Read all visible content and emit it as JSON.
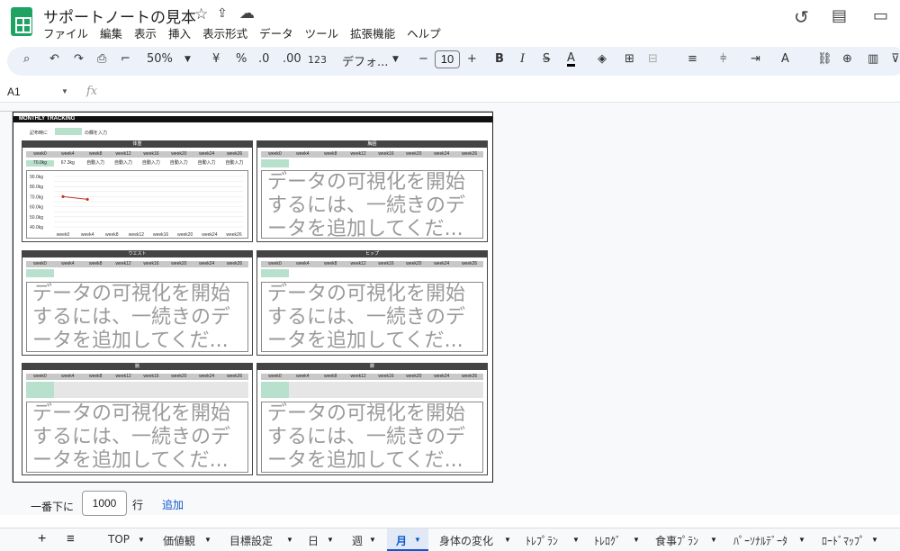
{
  "doc": {
    "title": "サポートノートの見本"
  },
  "menu": [
    "ファイル",
    "編集",
    "表示",
    "挿入",
    "表示形式",
    "データ",
    "ツール",
    "拡張機能",
    "ヘルプ"
  ],
  "toolbar": {
    "zoom": "50%",
    "yen": "¥",
    "percent": "%",
    "dec_dec": ".0",
    "dec_inc": ".00",
    "num_fmt": "123",
    "font": "デフォ...",
    "font_size": "10"
  },
  "cellref": "A1",
  "fx": "fx",
  "sheet": {
    "tracking_title": "MONTHLY TRACKING",
    "note_pre": "記布時に",
    "note_post": "の欄を入力"
  },
  "weeks": [
    "week0",
    "week4",
    "week8",
    "week12",
    "week16",
    "week20",
    "week24",
    "week26"
  ],
  "panels": {
    "weight": {
      "title": "体重",
      "values": [
        "70.0kg",
        "67.3kg",
        "自動入力",
        "自動入力",
        "自動入力",
        "自動入力",
        "自動入力",
        "自動入力"
      ]
    },
    "chest": {
      "title": "胸囲"
    },
    "waist": {
      "title": "ウエスト"
    },
    "hip": {
      "title": "ヒップ"
    },
    "arm": {
      "title": "腕"
    },
    "leg": {
      "title": "脚"
    }
  },
  "placeholder": "データの可視化を開始\nするには、一続きのデ\nータを追加してくだ...",
  "chart_data": {
    "type": "line",
    "categories": [
      "week0",
      "week4",
      "week8",
      "week12",
      "week16",
      "week20",
      "week24",
      "week26"
    ],
    "series": [
      {
        "values": [
          70.0,
          67.3,
          null,
          null,
          null,
          null,
          null,
          null
        ]
      }
    ],
    "ylim": [
      40,
      90
    ],
    "yticks": [
      "90.0kg",
      "80.0kg",
      "70.0kg",
      "60.0kg",
      "50.0kg",
      "40.0kg"
    ],
    "color": "#c0392b"
  },
  "bottom": {
    "prefix": "一番下に",
    "rows": "1000",
    "suffix": "行",
    "add": "追加"
  },
  "tabs": [
    "TOP",
    "価値観",
    "目標設定",
    "日",
    "週",
    "月",
    "身体の変化",
    "ﾄﾚﾌﾟﾗﾝ",
    "ﾄﾚﾛｸﾞ",
    "食事ﾌﾟﾗﾝ",
    "ﾊﾟｰｿﾅﾙﾃﾞｰﾀ",
    "ﾛｰﾄﾞﾏｯﾌﾟ"
  ],
  "colors": {
    "accent": "#0b57d0",
    "sheet_green": "#1ea362"
  }
}
